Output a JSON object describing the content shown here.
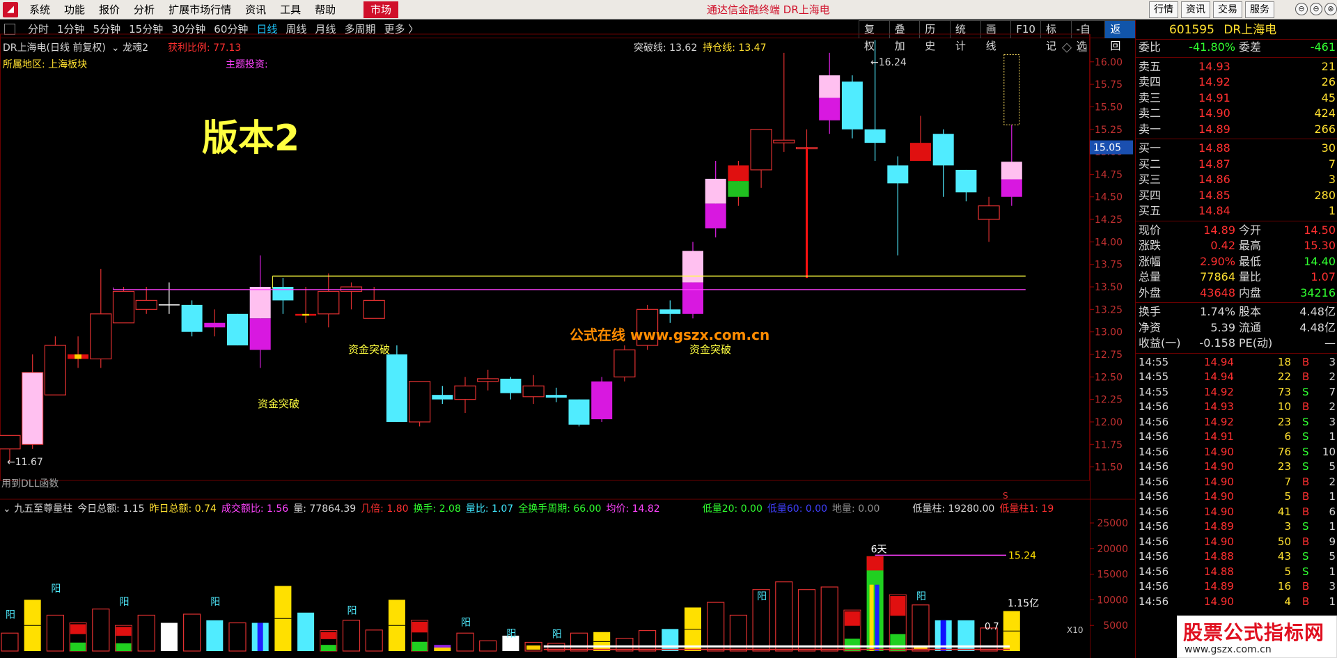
{
  "menubar": {
    "logo": "◢",
    "items": [
      "系统",
      "功能",
      "报价",
      "分析",
      "扩展市场行情",
      "资讯",
      "工具",
      "帮助"
    ],
    "market": "市场",
    "title": "通达信金融终端  DR上海电",
    "right_buttons": [
      "行情",
      "资讯",
      "交易",
      "服务"
    ],
    "window_controls": [
      "⊖",
      "⊖",
      "⊗"
    ]
  },
  "periodbar": {
    "periods": [
      "分时",
      "1分钟",
      "5分钟",
      "15分钟",
      "30分钟",
      "60分钟",
      "日线",
      "周线",
      "月线",
      "多周期",
      "更多 〉"
    ],
    "active_index": 6,
    "tools": [
      "复权",
      "叠加",
      "历史",
      "统计",
      "画线",
      "F10",
      "标记",
      "-自选",
      "返回"
    ]
  },
  "chart": {
    "stock_label": "DR上海电(日线 前复权)",
    "indicator": "龙魂2",
    "profit_label": "获利比例: 77.13",
    "region_label": "所属地区: 上海板块",
    "theme_label": "主题投资:",
    "break_line": "突破线: 13.62",
    "hold_line": "持仓线: 13.47",
    "version_text": "版本2",
    "watermark": "公式在线  www.gszx.com.cn",
    "annotations": [
      "资金突破",
      "资金突破",
      "资金突破"
    ],
    "low_label": "←11.67",
    "high_label": "←16.24",
    "current_price_tag": "15.05",
    "dll_text": "用到DLL函数",
    "y_ticks": [
      "16.00",
      "15.75",
      "15.50",
      "15.25",
      "15.00",
      "14.75",
      "14.50",
      "14.25",
      "14.00",
      "13.75",
      "13.50",
      "13.25",
      "13.00",
      "12.75",
      "12.50",
      "12.25",
      "12.00",
      "11.75",
      "11.50"
    ],
    "ylim": [
      11.35,
      16.3
    ],
    "break_value": 13.62,
    "hold_value": 13.47,
    "s_mark": "S"
  },
  "candles": [
    {
      "o": 11.7,
      "h": 11.85,
      "l": 11.55,
      "c": 11.85,
      "col": "red"
    },
    {
      "o": 11.75,
      "h": 12.75,
      "l": 11.7,
      "c": 12.55,
      "col": "pink"
    },
    {
      "o": 12.3,
      "h": 12.95,
      "l": 12.3,
      "c": 12.85,
      "col": "red"
    },
    {
      "o": 12.75,
      "h": 12.95,
      "l": 12.6,
      "c": 12.7,
      "col": "stripe"
    },
    {
      "o": 12.7,
      "h": 13.7,
      "l": 12.6,
      "c": 13.2,
      "col": "red"
    },
    {
      "o": 13.1,
      "h": 13.5,
      "l": 13.1,
      "c": 13.45,
      "col": "red"
    },
    {
      "o": 13.35,
      "h": 13.5,
      "l": 13.2,
      "c": 13.25,
      "col": "red"
    },
    {
      "o": 13.28,
      "h": 13.55,
      "l": 13.2,
      "c": 13.3,
      "col": "whitecross"
    },
    {
      "o": 13.3,
      "h": 13.35,
      "l": 12.95,
      "c": 13.0,
      "col": "cyan"
    },
    {
      "o": 13.05,
      "h": 13.25,
      "l": 12.95,
      "c": 13.1,
      "col": "magentadoji"
    },
    {
      "o": 13.2,
      "h": 13.2,
      "l": 12.85,
      "c": 12.85,
      "col": "cyan"
    },
    {
      "o": 12.8,
      "h": 13.85,
      "l": 12.6,
      "c": 13.5,
      "col": "pinkmag"
    },
    {
      "o": 13.5,
      "h": 13.6,
      "l": 13.2,
      "c": 13.35,
      "col": "cyan"
    },
    {
      "o": 13.2,
      "h": 13.5,
      "l": 13.1,
      "c": 13.18,
      "col": "stripe"
    },
    {
      "o": 13.2,
      "h": 13.65,
      "l": 13.05,
      "c": 13.45,
      "col": "red"
    },
    {
      "o": 13.45,
      "h": 13.55,
      "l": 13.25,
      "c": 13.5,
      "col": "reddoji"
    },
    {
      "o": 13.35,
      "h": 13.5,
      "l": 13.15,
      "c": 13.15,
      "col": "red"
    },
    {
      "o": 12.75,
      "h": 12.85,
      "l": 12.0,
      "c": 12.0,
      "col": "cyan"
    },
    {
      "o": 12.0,
      "h": 12.45,
      "l": 11.95,
      "c": 12.45,
      "col": "red"
    },
    {
      "o": 12.3,
      "h": 12.4,
      "l": 12.2,
      "c": 12.25,
      "col": "cyan"
    },
    {
      "o": 12.25,
      "h": 12.5,
      "l": 12.1,
      "c": 12.4,
      "col": "red"
    },
    {
      "o": 12.45,
      "h": 12.58,
      "l": 12.35,
      "c": 12.48,
      "col": "red"
    },
    {
      "o": 12.48,
      "h": 12.5,
      "l": 12.25,
      "c": 12.32,
      "col": "cyan"
    },
    {
      "o": 12.28,
      "h": 12.52,
      "l": 12.2,
      "c": 12.4,
      "col": "red"
    },
    {
      "o": 12.3,
      "h": 12.38,
      "l": 12.22,
      "c": 12.27,
      "col": "cyan"
    },
    {
      "o": 12.25,
      "h": 12.25,
      "l": 11.95,
      "c": 11.97,
      "col": "cyan"
    },
    {
      "o": 12.03,
      "h": 12.5,
      "l": 12.0,
      "c": 12.45,
      "col": "magenta"
    },
    {
      "o": 12.5,
      "h": 12.85,
      "l": 12.45,
      "c": 12.8,
      "col": "red"
    },
    {
      "o": 12.85,
      "h": 13.3,
      "l": 12.8,
      "c": 13.25,
      "col": "red"
    },
    {
      "o": 13.2,
      "h": 13.35,
      "l": 13.1,
      "c": 13.25,
      "col": "cyan"
    },
    {
      "o": 13.2,
      "h": 14.0,
      "l": 13.15,
      "c": 13.9,
      "col": "pinkmag"
    },
    {
      "o": 14.15,
      "h": 14.9,
      "l": 14.05,
      "c": 14.7,
      "col": "pinkmag"
    },
    {
      "o": 14.5,
      "h": 14.9,
      "l": 14.4,
      "c": 14.85,
      "col": "redgreen"
    },
    {
      "o": 14.8,
      "h": 15.25,
      "l": 14.6,
      "c": 15.25,
      "col": "red"
    },
    {
      "o": 15.1,
      "h": 16.1,
      "l": 15.0,
      "c": 15.13,
      "col": "reddoji"
    },
    {
      "o": 15.05,
      "h": 15.25,
      "l": 13.6,
      "c": 15.05,
      "col": "redline"
    },
    {
      "o": 15.35,
      "h": 16.1,
      "l": 15.2,
      "c": 15.85,
      "col": "pinkmag"
    },
    {
      "o": 15.78,
      "h": 15.85,
      "l": 15.15,
      "c": 15.25,
      "col": "cyan"
    },
    {
      "o": 15.25,
      "h": 16.24,
      "l": 14.9,
      "c": 15.1,
      "col": "cyan"
    },
    {
      "o": 14.85,
      "h": 14.95,
      "l": 13.85,
      "c": 14.65,
      "col": "cyan"
    },
    {
      "o": 14.9,
      "h": 15.4,
      "l": 14.9,
      "c": 15.1,
      "col": "redfill"
    },
    {
      "o": 15.2,
      "h": 15.25,
      "l": 14.5,
      "c": 14.85,
      "col": "cyan"
    },
    {
      "o": 14.8,
      "h": 14.8,
      "l": 14.45,
      "c": 14.55,
      "col": "cyan"
    },
    {
      "o": 14.25,
      "h": 14.5,
      "l": 14.0,
      "c": 14.4,
      "col": "red"
    },
    {
      "o": 14.5,
      "h": 15.3,
      "l": 14.4,
      "c": 14.89,
      "col": "pinkmag"
    }
  ],
  "sub_chart": {
    "title": "九五至尊量柱",
    "today": "今日总额: 1.15",
    "yesterday": "昨日总额: 0.74",
    "turnover_ratio": "成交额比: 1.56",
    "volume": "量: 77864.39",
    "times": "几倍: 1.80",
    "hand": "换手: 2.08",
    "vol_ratio": "量比: 1.07",
    "full_cycle": "全换手周期: 66.00",
    "avg": "均价: 14.82",
    "low20": "低量20: 0.00",
    "low60": "低量60: 0.00",
    "ground": "地量: 0.00",
    "low_bar": "低量柱: 19280.00",
    "low_bar2": "低量柱1: 19",
    "y_ticks": [
      "25000",
      "20000",
      "15000",
      "10000",
      "5000"
    ],
    "ylim": [
      0,
      26500
    ],
    "days_label": "6天",
    "level_label": "15.24",
    "yi_label": "1.15亿",
    "small_label": "0.7",
    "x10": "X10",
    "yang": "阳"
  },
  "volumes": [
    {
      "v": 3500,
      "t": "hollow"
    },
    {
      "v": 10000,
      "t": "yellow"
    },
    {
      "v": 7000,
      "t": "hollow"
    },
    {
      "v": 5500,
      "t": "redgreen"
    },
    {
      "v": 8200,
      "t": "hollow"
    },
    {
      "v": 5000,
      "t": "redgreen"
    },
    {
      "v": 7000,
      "t": "hollow"
    },
    {
      "v": 5500,
      "t": "white"
    },
    {
      "v": 7200,
      "t": "hollow"
    },
    {
      "v": 6000,
      "t": "cyan"
    },
    {
      "v": 5500,
      "t": "hollow"
    },
    {
      "v": 5500,
      "t": "cyanblue"
    },
    {
      "v": 12700,
      "t": "yellow"
    },
    {
      "v": 7500,
      "t": "cyan"
    },
    {
      "v": 4000,
      "t": "redgreen"
    },
    {
      "v": 6000,
      "t": "hollow"
    },
    {
      "v": 4100,
      "t": "hollow"
    },
    {
      "v": 10000,
      "t": "yellow"
    },
    {
      "v": 6000,
      "t": "redgreen"
    },
    {
      "v": 1200,
      "t": "purple"
    },
    {
      "v": 3500,
      "t": "hollow"
    },
    {
      "v": 2000,
      "t": "hollow"
    },
    {
      "v": 3000,
      "t": "white"
    },
    {
      "v": 1700,
      "t": "hollowyellow"
    },
    {
      "v": 1500,
      "t": "hollow"
    },
    {
      "v": 3500,
      "t": "hollow"
    },
    {
      "v": 3700,
      "t": "yellow"
    },
    {
      "v": 2500,
      "t": "hollow"
    },
    {
      "v": 4000,
      "t": "hollow"
    },
    {
      "v": 4300,
      "t": "cyan"
    },
    {
      "v": 8500,
      "t": "yellow"
    },
    {
      "v": 9500,
      "t": "hollow"
    },
    {
      "v": 7000,
      "t": "hollow"
    },
    {
      "v": 12000,
      "t": "hollow"
    },
    {
      "v": 13500,
      "t": "hollow"
    },
    {
      "v": 12000,
      "t": "hollow"
    },
    {
      "v": 12500,
      "t": "hollow"
    },
    {
      "v": 8000,
      "t": "redgreen"
    },
    {
      "v": 18500,
      "t": "mixedhigh"
    },
    {
      "v": 11000,
      "t": "redgreen"
    },
    {
      "v": 9000,
      "t": "hollowyellow"
    },
    {
      "v": 6000,
      "t": "blue"
    },
    {
      "v": 6000,
      "t": "cyan"
    },
    {
      "v": 4500,
      "t": "hollow"
    },
    {
      "v": 7800,
      "t": "yellow"
    }
  ],
  "rpanel": {
    "code": "601595",
    "name": "DR上海电",
    "ratio_row": {
      "l1": "委比",
      "v1": "-41.80%",
      "l2": "委差",
      "v2": "-461"
    },
    "asks": [
      {
        "l": "卖五",
        "p": "14.93",
        "v": "21"
      },
      {
        "l": "卖四",
        "p": "14.92",
        "v": "26"
      },
      {
        "l": "卖三",
        "p": "14.91",
        "v": "45"
      },
      {
        "l": "卖二",
        "p": "14.90",
        "v": "424"
      },
      {
        "l": "卖一",
        "p": "14.89",
        "v": "266"
      }
    ],
    "bids": [
      {
        "l": "买一",
        "p": "14.88",
        "v": "30"
      },
      {
        "l": "买二",
        "p": "14.87",
        "v": "7"
      },
      {
        "l": "买三",
        "p": "14.86",
        "v": "3"
      },
      {
        "l": "买四",
        "p": "14.85",
        "v": "280"
      },
      {
        "l": "买五",
        "p": "14.84",
        "v": "1"
      }
    ],
    "quote": [
      {
        "l1": "现价",
        "v1": "14.89",
        "c1": "red",
        "l2": "今开",
        "v2": "14.50",
        "c2": "red"
      },
      {
        "l1": "涨跌",
        "v1": "0.42",
        "c1": "red",
        "l2": "最高",
        "v2": "15.30",
        "c2": "red"
      },
      {
        "l1": "涨幅",
        "v1": "2.90%",
        "c1": "red",
        "l2": "最低",
        "v2": "14.40",
        "c2": "green"
      },
      {
        "l1": "总量",
        "v1": "77864",
        "c1": "yellow",
        "l2": "量比",
        "v2": "1.07",
        "c2": "red"
      },
      {
        "l1": "外盘",
        "v1": "43648",
        "c1": "red",
        "l2": "内盘",
        "v2": "34216",
        "c2": "green"
      }
    ],
    "fund": [
      {
        "l1": "换手",
        "v1": "1.74%",
        "l2": "股本",
        "v2": "4.48亿"
      },
      {
        "l1": "净资",
        "v1": "5.39",
        "l2": "流通",
        "v2": "4.48亿"
      },
      {
        "l1": "收益(一)",
        "v1": "-0.158",
        "l2": "PE(动)",
        "v2": "—"
      }
    ],
    "ticks": [
      {
        "t": "14:55",
        "p": "14.94",
        "v": "18",
        "s": "B",
        "e": "3"
      },
      {
        "t": "14:55",
        "p": "14.94",
        "v": "22",
        "s": "B",
        "e": "2"
      },
      {
        "t": "14:55",
        "p": "14.92",
        "v": "73",
        "s": "S",
        "e": "7"
      },
      {
        "t": "14:56",
        "p": "14.93",
        "v": "10",
        "s": "B",
        "e": "2"
      },
      {
        "t": "14:56",
        "p": "14.92",
        "v": "23",
        "s": "S",
        "e": "3"
      },
      {
        "t": "14:56",
        "p": "14.91",
        "v": "6",
        "s": "S",
        "e": "1"
      },
      {
        "t": "14:56",
        "p": "14.90",
        "v": "76",
        "s": "S",
        "e": "10"
      },
      {
        "t": "14:56",
        "p": "14.90",
        "v": "23",
        "s": "S",
        "e": "5"
      },
      {
        "t": "14:56",
        "p": "14.90",
        "v": "7",
        "s": "B",
        "e": "2"
      },
      {
        "t": "14:56",
        "p": "14.90",
        "v": "5",
        "s": "B",
        "e": "1"
      },
      {
        "t": "14:56",
        "p": "14.90",
        "v": "41",
        "s": "B",
        "e": "6"
      },
      {
        "t": "14:56",
        "p": "14.89",
        "v": "3",
        "s": "S",
        "e": "1"
      },
      {
        "t": "14:56",
        "p": "14.90",
        "v": "50",
        "s": "B",
        "e": "9"
      },
      {
        "t": "14:56",
        "p": "14.88",
        "v": "43",
        "s": "S",
        "e": "5"
      },
      {
        "t": "14:56",
        "p": "14.88",
        "v": "5",
        "s": "S",
        "e": "1"
      },
      {
        "t": "14:56",
        "p": "14.89",
        "v": "16",
        "s": "B",
        "e": "3"
      },
      {
        "t": "14:56",
        "p": "14.90",
        "v": "4",
        "s": "B",
        "e": "1"
      }
    ]
  },
  "watermark_br": {
    "title": "股票公式指标网",
    "url": "www.gszx.com.cn"
  }
}
